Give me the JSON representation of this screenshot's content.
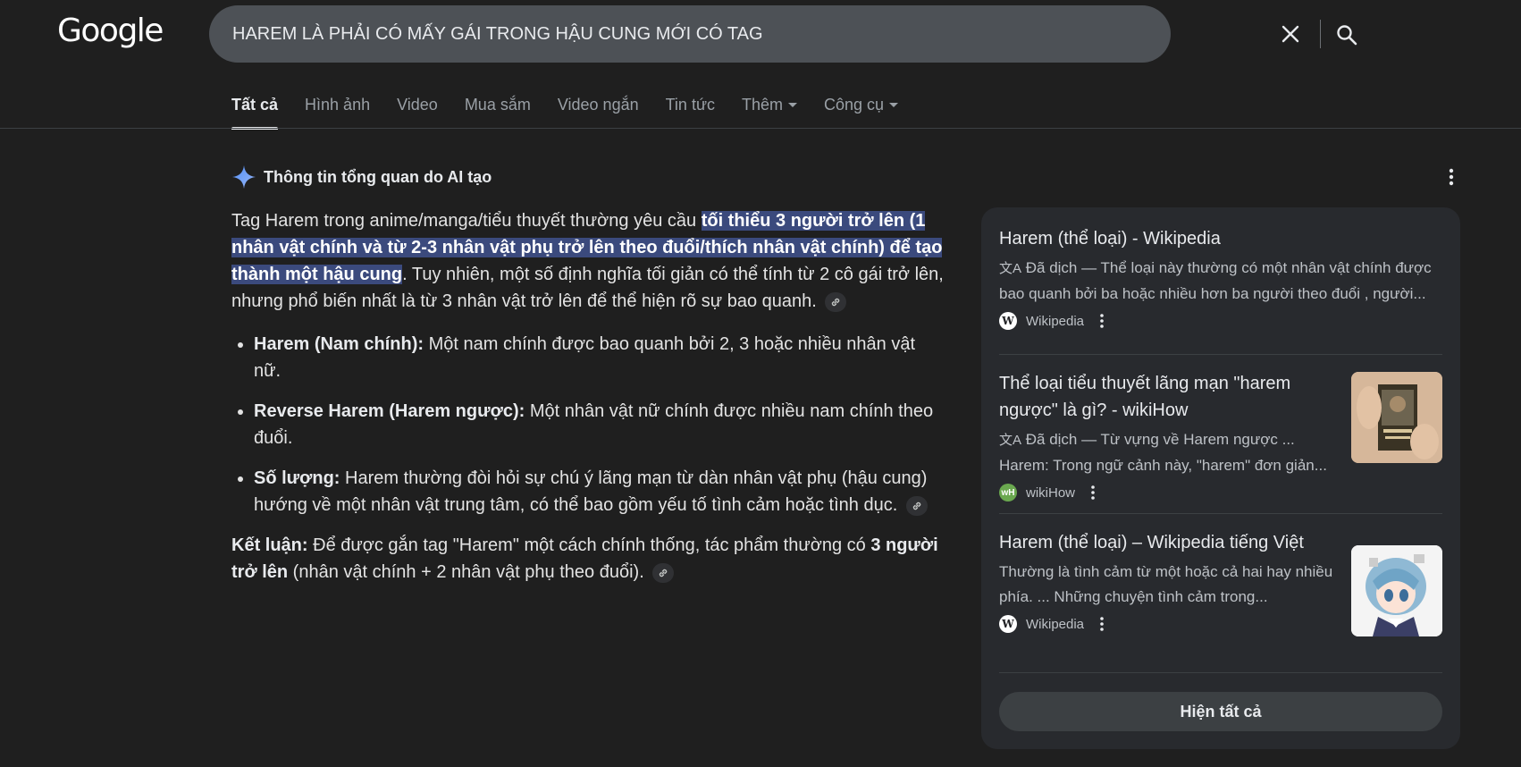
{
  "header": {
    "logo_text": "Google",
    "search": {
      "value": "HAREM LÀ PHẢI CÓ MẤY GÁI TRONG HẬU CUNG MỚI CÓ TAG",
      "clear_icon": "close-icon",
      "search_icon": "search-icon"
    }
  },
  "tabs": [
    {
      "label": "Tất cả",
      "active": true
    },
    {
      "label": "Hình ảnh"
    },
    {
      "label": "Video"
    },
    {
      "label": "Mua sắm"
    },
    {
      "label": "Video ngắn"
    },
    {
      "label": "Tin tức"
    },
    {
      "label": "Thêm",
      "dropdown": true
    },
    {
      "label": "Công cụ",
      "dropdown": true
    }
  ],
  "ai_overview": {
    "header_label": "Thông tin tổng quan do AI tạo",
    "intro_before": "Tag Harem trong anime/manga/tiểu thuyết thường yêu cầu ",
    "intro_highlight": "tối thiểu 3 người trở lên (1 nhân vật chính và từ 2-3 nhân vật phụ trở lên theo đuổi/thích nhân vật chính) để tạo thành một hậu cung",
    "intro_after": ". Tuy nhiên, một số định nghĩa tối giản có thể tính từ 2 cô gái trở lên, nhưng phổ biến nhất là từ 3 nhân vật trở lên để thể hiện rõ sự bao quanh.",
    "bullets": [
      {
        "term": "Harem (Nam chính):",
        "text": " Một nam chính được bao quanh bởi 2, 3 hoặc nhiều nhân vật nữ."
      },
      {
        "term": "Reverse Harem (Harem ngược):",
        "text": " Một nhân vật nữ chính được nhiều nam chính theo đuổi."
      },
      {
        "term": "Số lượng:",
        "text": " Harem thường đòi hỏi sự chú ý lãng mạn từ dàn nhân vật phụ (hậu cung) hướng về một nhân vật trung tâm, có thể bao gồm yếu tố tình cảm hoặc tình dục."
      }
    ],
    "conclusion": {
      "term": "Kết luận:",
      "text_before": " Để được gắn tag \"Harem\" một cách chính thống, tác phẩm thường có ",
      "bold": "3 người trở lên",
      "text_after": " (nhân vật chính + 2 nhân vật phụ theo đuổi)."
    }
  },
  "sources": {
    "items": [
      {
        "title": "Harem (thể loại) - Wikipedia",
        "snippet": "Đã dịch — Thể loại này thường có một nhân vật chính được bao quanh bởi ba hoặc nhiều hơn ba người theo đuổi , người...",
        "site": "Wikipedia",
        "favicon": "W"
      },
      {
        "title": "Thể loại tiểu thuyết lãng mạn \"harem ngược\" là gì? - wikiHow",
        "snippet_1": "Đã dịch — Từ vựng về Harem ngược ...",
        "snippet_2": "Harem: Trong ngữ cảnh này, \"harem\" đơn giản...",
        "site": "wikiHow",
        "favicon": "wH"
      },
      {
        "title": "Harem (thể loại) – Wikipedia tiếng Việt",
        "snippet": "Thường là tình cảm từ một hoặc cả hai hay nhiều phía. ... Những chuyện tình cảm trong...",
        "site": "Wikipedia",
        "favicon": "W"
      }
    ],
    "show_all_label": "Hiện tất cả"
  },
  "colors": {
    "background": "#1f1f1f",
    "highlight": "#3b4a7d",
    "panel": "#282a2e",
    "searchbar": "#4d5156"
  }
}
